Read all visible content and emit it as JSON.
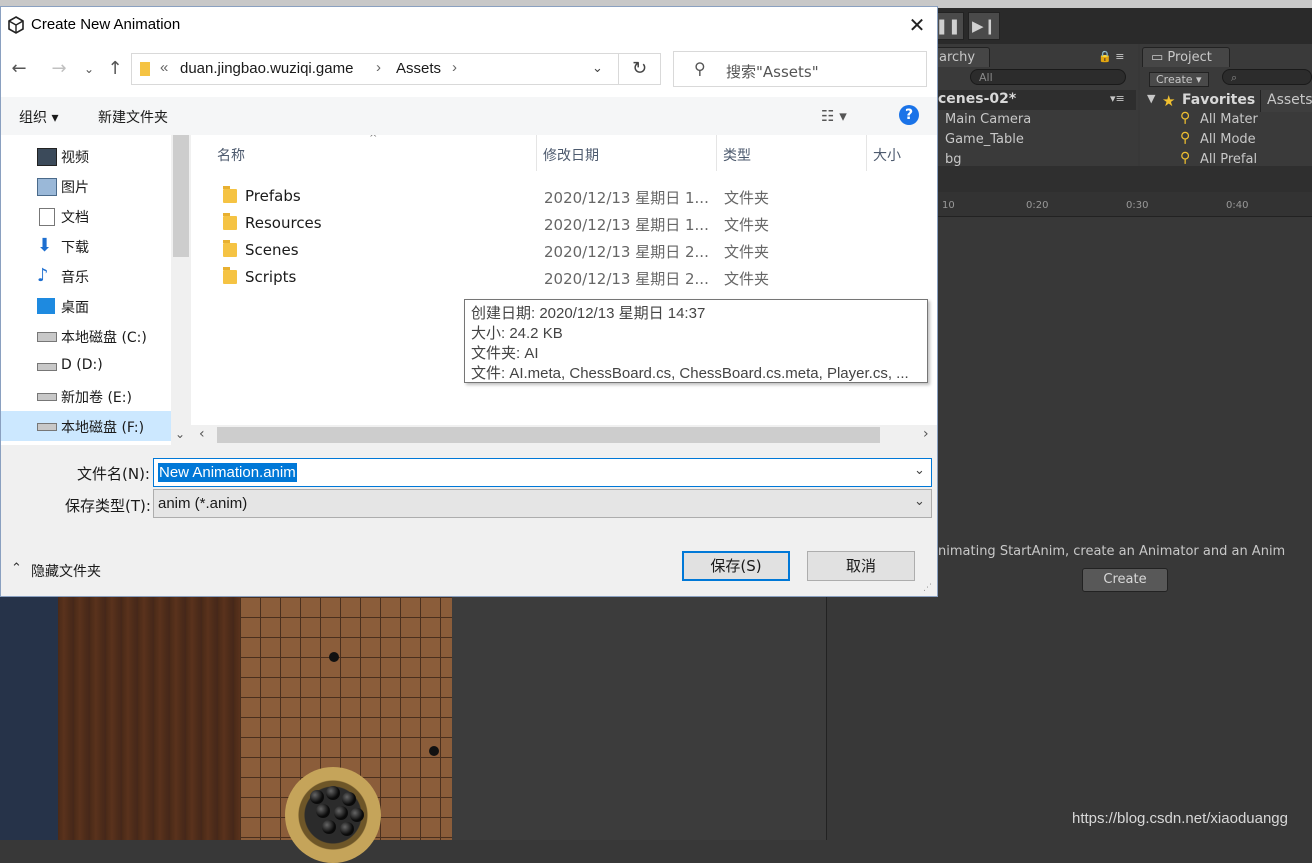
{
  "dialog": {
    "title": "Create New Animation",
    "close_glyph": "✕",
    "address": {
      "prefix": "«",
      "segment1": "duan.jingbao.wuziqi.game",
      "segment2": "Assets"
    },
    "search_placeholder": "搜索\"Assets\"",
    "toolbar": {
      "organize": "组织 ▾",
      "new_folder": "新建文件夹",
      "help": "?"
    },
    "nav_items": [
      {
        "label": "视频",
        "icon": "video-icon"
      },
      {
        "label": "图片",
        "icon": "pictures-icon"
      },
      {
        "label": "文档",
        "icon": "documents-icon"
      },
      {
        "label": "下载",
        "icon": "downloads-icon"
      },
      {
        "label": "音乐",
        "icon": "music-icon"
      },
      {
        "label": "桌面",
        "icon": "desktop-icon"
      },
      {
        "label": "本地磁盘 (C:)",
        "icon": "system-drive-icon"
      },
      {
        "label": "D (D:)",
        "icon": "drive-icon"
      },
      {
        "label": "新加卷 (E:)",
        "icon": "drive-icon"
      },
      {
        "label": "本地磁盘 (F:)",
        "icon": "drive-icon",
        "selected": true
      }
    ],
    "columns": {
      "name": "名称",
      "modified": "修改日期",
      "type": "类型",
      "size": "大小"
    },
    "files": [
      {
        "name": "Prefabs",
        "modified": "2020/12/13 星期日 1...",
        "type": "文件夹"
      },
      {
        "name": "Resources",
        "modified": "2020/12/13 星期日 1...",
        "type": "文件夹"
      },
      {
        "name": "Scenes",
        "modified": "2020/12/13 星期日 2...",
        "type": "文件夹"
      },
      {
        "name": "Scripts",
        "modified": "2020/12/13 星期日 2...",
        "type": "文件夹"
      }
    ],
    "tooltip": {
      "created": "创建日期: 2020/12/13 星期日 14:37",
      "size": "大小: 24.2 KB",
      "folder": "文件夹: AI",
      "files": "文件: AI.meta, ChessBoard.cs, ChessBoard.cs.meta, Player.cs, ..."
    },
    "filename_label": "文件名(N):",
    "filename_value": "New Animation.anim",
    "filetype_label": "保存类型(T):",
    "filetype_value": "anim (*.anim)",
    "hide_folders": "隐藏文件夹",
    "save_button": "保存(S)",
    "cancel_button": "取消"
  },
  "unity": {
    "hierarchy_tab": "archy",
    "project_tab": "Project",
    "hierarchy_search": "All",
    "project_create": "Create ▾",
    "scene_name": "cenes-02*",
    "hierarchy_items": [
      "Main Camera",
      "Game_Table",
      "bg"
    ],
    "favorites_label": "Favorites",
    "assets_label": "Assets",
    "favorites_items": [
      "All Mater",
      "All Mode",
      "All Prefal"
    ],
    "ruler_ticks": [
      "10",
      "0:20",
      "0:30",
      "0:40"
    ],
    "animator_message": "nimating StartAnim, create an Animator and an Anim",
    "create_button": "Create",
    "watermark": "https://blog.csdn.net/xiaoduangg"
  }
}
